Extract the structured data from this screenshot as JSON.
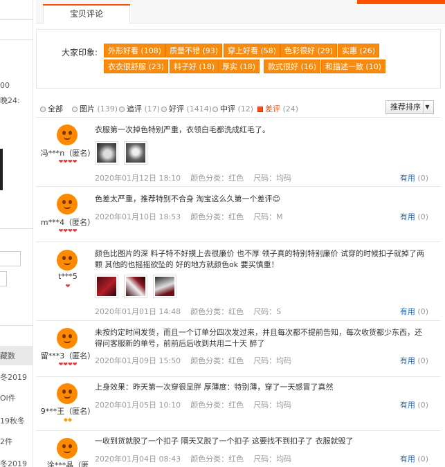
{
  "sidebar": {
    "fragments": [
      "00",
      "晚24:",
      "藏数",
      "冬2019",
      "Ol件",
      "19秋冬",
      "2件",
      "冬2019"
    ]
  },
  "tab": {
    "label": "宝贝评论"
  },
  "impressions": {
    "label": "大家印象:",
    "tags": [
      "外形好看 (108)",
      "质量不错 (93)",
      "穿上好看 (58)",
      "色彩很好 (29)",
      "实惠 (26)",
      "衣衣很舒服 (23)",
      "料子好 (18)",
      "厚实 (18)",
      "款式很好 (16)",
      "和描述一致 (10)"
    ]
  },
  "filter": {
    "options": [
      {
        "label": "全部",
        "count": ""
      },
      {
        "label": "图片",
        "count": "(139)"
      },
      {
        "label": "追评",
        "count": "(17)"
      },
      {
        "label": "好评",
        "count": "(1414)"
      },
      {
        "label": "中评",
        "count": "(12)"
      },
      {
        "label": "差评",
        "count": "(24)"
      }
    ],
    "selected": "差评",
    "sort_label": "推荐排序"
  },
  "reviews": [
    {
      "user": "冯***n（匿名）",
      "rank": "❤❤❤❤",
      "text": "衣服第一次掉色特别严重，衣领白毛都洗成红毛了。",
      "date": "2020年01月12日 18:10",
      "color": "颜色分类：红色",
      "size": "尺码：均码",
      "useful": "有用",
      "useful_count": "(0)"
    },
    {
      "user": "m***4（匿名）",
      "rank": "❤❤❤❤",
      "text": "色差太严重，推荐特别不合身 淘宝这么久第一个差评😊",
      "date": "2020年01月10日 18:53",
      "color": "颜色分类：红色",
      "size": "尺码：M",
      "useful": "有用",
      "useful_count": "(0)"
    },
    {
      "user": "t***5",
      "rank": "❤",
      "text": "颜色比图片的深 料子特不好摸上去很廉价 也不厚 领子真的特别特别廉价 试穿的时候扣子就掉了两颗 其他的也摇摇欲坠的 好的地方就颜色ok 要买慎重！",
      "date": "2020年01月01日 14:48",
      "color": "颜色分类：红色",
      "size": "尺码：S",
      "useful": "有用",
      "useful_count": "(0)"
    },
    {
      "user": "留***3（匿名）",
      "rank": "❤❤❤❤",
      "text": "未按约定时间发货，而且一个订单分四次发过来，并且每次都不提前告知，每次收货都少东西，还得问客服新的单号，前前后后收到共用二十天 醉了",
      "date": "2020年01月09日 15:50",
      "color": "颜色分类：红色",
      "size": "尺码：均码",
      "useful": "有用",
      "useful_count": "(0)"
    },
    {
      "user": "9***王（匿名）",
      "rank": "◆◆",
      "text": "上身效果：昨天第一次穿很显胖 厚薄度：特别薄，穿了一天感冒了真然",
      "date": "2020年01月05日 10:10",
      "color": "颜色分类：红色",
      "size": "尺码：均码",
      "useful": "有用",
      "useful_count": "(0)"
    },
    {
      "user": "涂***晶（匿",
      "rank": "",
      "text": "一收到货就脱了一个扣子 隔天又脱了一个扣子 这要找不到扣子了 衣服就毁了",
      "date": "2020年01月04日 08:43",
      "color": "颜色分类：红色",
      "size": "尺码：均码",
      "useful": "有用",
      "useful_count": "(0)"
    }
  ],
  "colors": {
    "accent": "#ff5000",
    "tag_bg": "#f78b10",
    "link": "#2a6ab5"
  }
}
